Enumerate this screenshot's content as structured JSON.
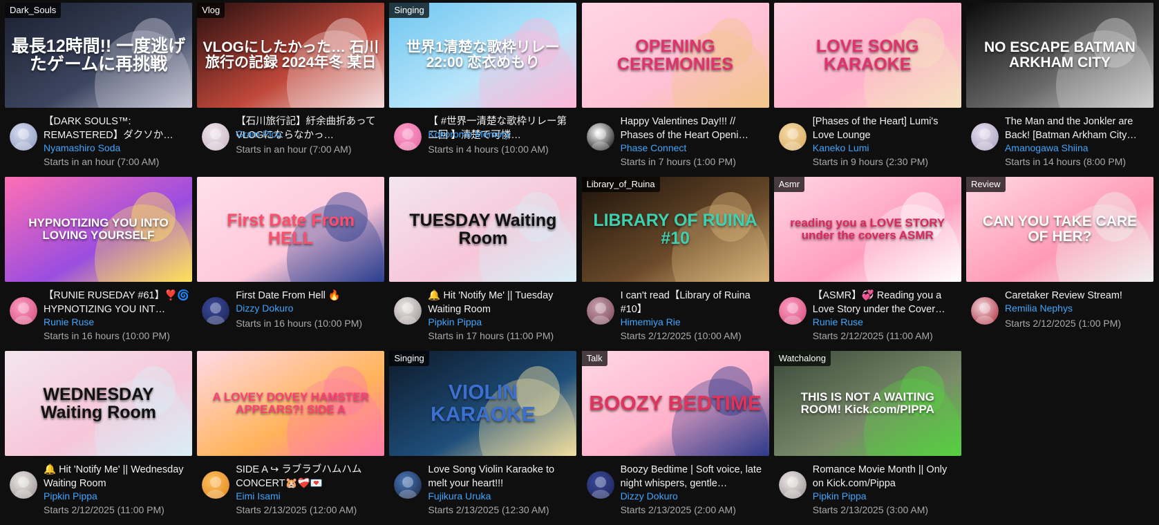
{
  "videos": [
    {
      "tag": "Dark_Souls",
      "thumb_text": "最長12時間!! 一度逃げたゲームに再挑戦",
      "thumb_colors": [
        "#1b2030",
        "#3d4660",
        "#c8c8d8"
      ],
      "text_color": "#ffffff",
      "title": "【DARK SOULS™: REMASTERED】ダクソか…",
      "channel": "Nyamashiro Soda",
      "status": "Starts in an hour (7:00 AM)",
      "avatar_colors": [
        "#d9dff0",
        "#8c98c0"
      ]
    },
    {
      "tag": "Vlog",
      "thumb_text": "VLOGにしたかった… 石川旅行の記録 2024年冬 某日",
      "thumb_colors": [
        "#2a1010",
        "#c0483a",
        "#f3dede"
      ],
      "text_color": "#ffffff",
      "title": "【石川旅行記】紆余曲折あってVLOGにならなかっ…",
      "channel": "Gram Pico",
      "status": "Starts in an hour (7:00 AM)",
      "avatar_colors": [
        "#f0e6ea",
        "#c7b5c6"
      ]
    },
    {
      "tag": "Singing",
      "thumb_text": "世界1清楚な歌枠リレー 22:00 恋衣めもり",
      "thumb_colors": [
        "#6fc6f0",
        "#b9e6fb",
        "#ffb6d8"
      ],
      "text_color": "#ffffff",
      "title": "【 #世界一清楚な歌枠リレー第二回 】清楚で可憐…",
      "channel": "Kokoromo Memory",
      "status": "Starts in 4 hours (10:00 AM)",
      "avatar_colors": [
        "#ff9cc8",
        "#e26aa4"
      ]
    },
    {
      "tag": "",
      "thumb_text": "OPENING CEREMONIES",
      "thumb_colors": [
        "#ffd6e4",
        "#ffc0d6",
        "#f2c68a"
      ],
      "text_color": "#e0336c",
      "title": "Happy Valentines Day!!! // Phases of the Heart Openi…",
      "channel": "Phase Connect",
      "status": "Starts in 7 hours (1:00 PM)",
      "avatar_colors": [
        "#ffffff",
        "#111111"
      ]
    },
    {
      "tag": "",
      "thumb_text": "LOVE SONG KARAOKE",
      "thumb_colors": [
        "#ffd1e2",
        "#ffb2cc",
        "#f5e1c0"
      ],
      "text_color": "#e0336c",
      "title": "[Phases of the Heart] Lumi's Love Lounge",
      "channel": "Kaneko Lumi",
      "status": "Starts in 9 hours (2:30 PM)",
      "avatar_colors": [
        "#f6dcaa",
        "#d8a95e"
      ]
    },
    {
      "tag": "",
      "thumb_text": "NO ESCAPE BATMAN ARKHAM CITY",
      "thumb_colors": [
        "#0a0a0a",
        "#6a6a6a",
        "#d0d0d0"
      ],
      "text_color": "#ffffff",
      "title": "The Man and the Jonkler are Back! [Batman Arkham City…",
      "channel": "Amanogawa Shiina",
      "status": "Starts in 14 hours (8:00 PM)",
      "avatar_colors": [
        "#e8e0f0",
        "#a8a0c0"
      ]
    },
    {
      "tag": "",
      "thumb_text": "HYPNOTIZING YOU INTO LOVING YOURSELF",
      "thumb_colors": [
        "#ff6fb3",
        "#9a4de0",
        "#ffe35a"
      ],
      "text_color": "#ffffff",
      "title": "【RUNIE RUSEDAY #61】❣️🌀 HYPNOTIZING YOU INT…",
      "channel": "Runie Ruse",
      "status": "Starts in 16 hours (10:00 PM)",
      "avatar_colors": [
        "#ff9cc0",
        "#d4507e"
      ]
    },
    {
      "tag": "",
      "thumb_text": "First Date From HELL",
      "thumb_colors": [
        "#ffe0ea",
        "#ffc8da",
        "#2a3f8f"
      ],
      "text_color": "#ff4d6d",
      "title": "First Date From Hell 🔥",
      "channel": "Dizzy Dokuro",
      "status": "Starts in 16 hours (10:00 PM)",
      "avatar_colors": [
        "#3a4a9a",
        "#1d2559"
      ]
    },
    {
      "tag": "",
      "thumb_text": "TUESDAY Waiting Room",
      "thumb_colors": [
        "#f3e6ee",
        "#f7c6d8",
        "#d9eef7"
      ],
      "text_color": "#111111",
      "title": "🔔 Hit 'Notify Me' || Tuesday Waiting Room",
      "channel": "Pipkin Pippa",
      "status": "Starts in 17 hours (11:00 PM)",
      "avatar_colors": [
        "#ece8e8",
        "#9d9494"
      ]
    },
    {
      "tag": "Library_of_Ruina",
      "thumb_text": "LIBRARY OF RUINA #10",
      "thumb_colors": [
        "#1c120a",
        "#6a4a2a",
        "#d8b47a"
      ],
      "text_color": "#3fd0b0",
      "title": "I can't read【Library of Ruina #10】",
      "channel": "Himemiya Rie",
      "status": "Starts 2/12/2025 (10:00 AM)",
      "avatar_colors": [
        "#caa0b0",
        "#7a4a5a"
      ]
    },
    {
      "tag": "Asmr",
      "thumb_text": "reading you a LOVE STORY under the covers ASMR",
      "thumb_colors": [
        "#ffd6e4",
        "#ff9ec0",
        "#ffffff"
      ],
      "text_color": "#d8285e",
      "title": "【ASMR】💞 Reading you a Love Story under the Cover…",
      "channel": "Runie Ruse",
      "status": "Starts 2/12/2025 (11:00 AM)",
      "avatar_colors": [
        "#ff9cc0",
        "#d4507e"
      ]
    },
    {
      "tag": "Review",
      "thumb_text": "CAN YOU TAKE CARE OF HER?",
      "thumb_colors": [
        "#ffd8e4",
        "#ff9ab6",
        "#f0f0f0"
      ],
      "text_color": "#ffffff",
      "title": "Caretaker Review Stream!",
      "channel": "Remilia Nephys",
      "status": "Starts 2/12/2025 (1:00 PM)",
      "avatar_colors": [
        "#f2d6dc",
        "#b03040"
      ]
    },
    {
      "tag": "",
      "thumb_text": "WEDNESDAY Waiting Room",
      "thumb_colors": [
        "#f3e6ee",
        "#f7c6d8",
        "#d9eef7"
      ],
      "text_color": "#111111",
      "title": "🔔 Hit 'Notify Me' || Wednesday Waiting Room",
      "channel": "Pipkin Pippa",
      "status": "Starts 2/12/2025 (11:00 PM)",
      "avatar_colors": [
        "#ece8e8",
        "#9d9494"
      ]
    },
    {
      "tag": "",
      "thumb_text": "A LOVEY DOVEY HAMSTER APPEARS?! SIDE A",
      "thumb_colors": [
        "#ffd9e6",
        "#ffb35a",
        "#ff7aa8"
      ],
      "text_color": "#ff3f74",
      "title": "SIDE A ↪ ラブラブハムハム CONCERT🐹❤️‍🩹💌",
      "channel": "Eimi Isami",
      "status": "Starts 2/13/2025 (12:00 AM)",
      "avatar_colors": [
        "#ffc060",
        "#e08a20"
      ]
    },
    {
      "tag": "Singing",
      "thumb_text": "VIOLIN KARAOKE",
      "thumb_colors": [
        "#0e1a2a",
        "#1e4e7a",
        "#f2e0a0"
      ],
      "text_color": "#3b6fd0",
      "title": "Love Song Violin Karaoke to melt your heart!!!",
      "channel": "Fujikura Uruka",
      "status": "Starts 2/13/2025 (12:30 AM)",
      "avatar_colors": [
        "#4a78b8",
        "#1a2a4a"
      ]
    },
    {
      "tag": "Talk",
      "thumb_text": "BOOZY BEDTIME",
      "thumb_colors": [
        "#ffd8e4",
        "#ffb0ca",
        "#2c3a8a"
      ],
      "text_color": "#e0335c",
      "title": "Boozy Bedtime | Soft voice, late night whispers, gentle…",
      "channel": "Dizzy Dokuro",
      "status": "Starts 2/13/2025 (2:00 AM)",
      "avatar_colors": [
        "#3a4a9a",
        "#1d2559"
      ]
    },
    {
      "tag": "Watchalong",
      "thumb_text": "THIS IS NOT A WAITING ROOM! Kick.com/PIPPA",
      "thumb_colors": [
        "#3a4a3a",
        "#7a8a6a",
        "#56d040"
      ],
      "text_color": "#ffffff",
      "title": "Romance Movie Month || Only on Kick.com/Pippa",
      "channel": "Pipkin Pippa",
      "status": "Starts 2/13/2025 (3:00 AM)",
      "avatar_colors": [
        "#ece8e8",
        "#9d9494"
      ]
    }
  ]
}
